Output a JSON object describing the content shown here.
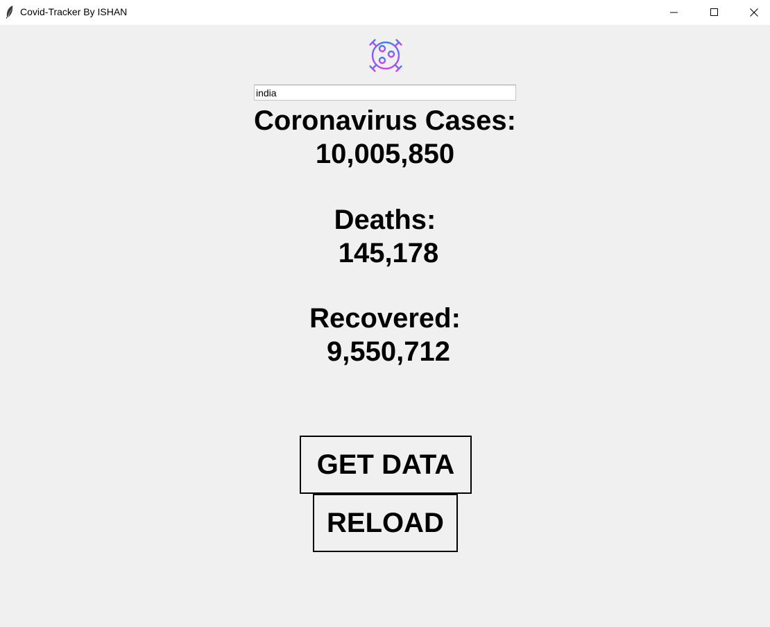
{
  "window": {
    "title": "Covid-Tracker By ISHAN"
  },
  "search": {
    "value": "india"
  },
  "stats": {
    "cases_label": "Coronavirus Cases:",
    "cases_value": "10,005,850",
    "deaths_label": "Deaths:",
    "deaths_value": "145,178",
    "recovered_label": "Recovered:",
    "recovered_value": "9,550,712"
  },
  "buttons": {
    "get_data": "GET DATA",
    "reload": "RELOAD"
  },
  "icons": {
    "app": "feather-icon",
    "logo": "virus-icon",
    "minimize": "minimize-icon",
    "maximize": "maximize-icon",
    "close": "close-icon"
  },
  "colors": {
    "background": "#f0f0f0",
    "logo_gradient_start": "#3f7bff",
    "logo_gradient_end": "#d63af0"
  }
}
